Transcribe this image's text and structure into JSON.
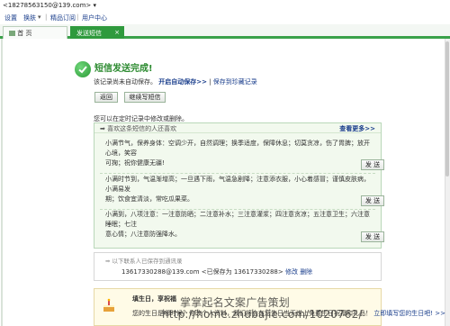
{
  "account": {
    "email": "<18278563150@139.com> ▾"
  },
  "menu": {
    "settings": "设置",
    "switch_skin": "换肤",
    "skin_arrow": "▾",
    "boutique": "精品订阅",
    "user_center": "用户中心"
  },
  "tabs": [
    {
      "label": "首 页",
      "icon": "home-icon"
    },
    {
      "label": "发送短信",
      "close": "×"
    }
  ],
  "result": {
    "title": "短信发送完成!",
    "notice_prefix": "该记录尚未自动保存。",
    "auto_save_link": "开启自动保存>>",
    "separator": "|",
    "save_favorite_link": "保存到珍藏记录",
    "back_button": "返回",
    "continue_button": "继续写短信"
  },
  "hint": "您可以在定时记录中修改或删除。",
  "recommend": {
    "title": "喜欢这条短信的人还喜欢",
    "more": "查看更多>>",
    "send_label": "发 送",
    "items": [
      {
        "text_line1": "小满节气，保养身体：空调少开，自然调理；换季适度，保障休息；切莫贪凉，伤了胃脾；放开心境，笑容",
        "text_line2": "可掬；祝你健康无疆!"
      },
      {
        "text_line1": "小满时节到，气温渐增高；一旦遇下雨，气温急剧降；注意添衣服，小心着感冒；谨慎皮肤病，小满易发",
        "text_line2": "期；饮食宜清淡，常吃瓜果菜。"
      },
      {
        "text_line1": "小满到，八项注意：一注意防晒；二注意补水；三注意灌浆；四注意贪凉；五注意卫生；六注意睡眠；七注",
        "text_line2": "意心情；八注意防强降水。"
      }
    ]
  },
  "record": {
    "title": "以下联系人已保存到通讯录",
    "contact": "13617330288@139.com",
    "saved_as": "<已保存为 13617330288>",
    "modify": "修改",
    "delete": "删除"
  },
  "birthday": {
    "title": "填生日，享祝福",
    "text": "您的生日是哪时候？修改个人资料，我们将会在您生日当天送上免费生日祝福和礼品！",
    "link": "立即填写您的生日吧!",
    "arrow": ">>"
  },
  "watermark": {
    "line1": "掌掌起名文案广告策划",
    "line2": "http://home.zhubajie.com/1020762/"
  }
}
